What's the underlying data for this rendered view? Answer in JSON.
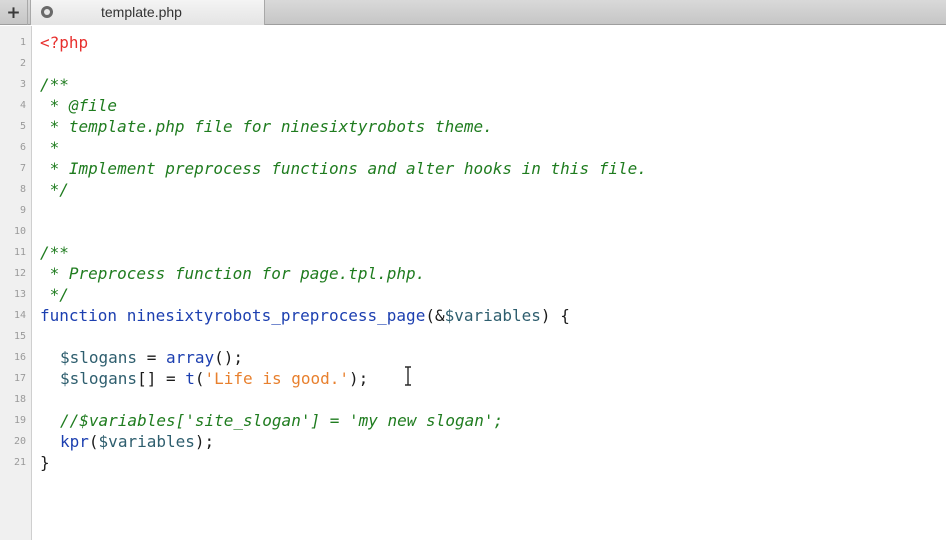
{
  "tabbar": {
    "add_label": "+",
    "tab": {
      "title": "template.php"
    }
  },
  "gutter": {
    "line_numbers": [
      "1",
      "2",
      "3",
      "4",
      "5",
      "6",
      "7",
      "8",
      "9",
      "10",
      "11",
      "12",
      "13",
      "14",
      "15",
      "16",
      "17",
      "18",
      "19",
      "20",
      "21"
    ]
  },
  "code": {
    "line1": "<?php",
    "line3": "/**",
    "line4": " * @file",
    "line5": " * template.php file for ninesixtyrobots theme.",
    "line6": " *",
    "line7": " * Implement preprocess functions and alter hooks in this file.",
    "line8": " */",
    "line11": "/**",
    "line12": " * Preprocess function for page.tpl.php.",
    "line13": " */",
    "line14": {
      "kw": "function",
      "name": "ninesixtyrobots_preprocess_page",
      "open": "(&",
      "var": "$variables",
      "close": ") {"
    },
    "line16": {
      "var": "$slogans",
      "eq": " = ",
      "fn": "array",
      "rest": "();"
    },
    "line17": {
      "var": "$slogans",
      "mid": "[] = ",
      "fn": "t",
      "open": "(",
      "str": "'Life is good.'",
      "close": ");"
    },
    "line19": "//$variables['site_slogan'] = 'my new slogan';",
    "line20": {
      "fn": "kpr",
      "open": "(",
      "var": "$variables",
      "close": ");"
    },
    "line21": "}"
  },
  "colors": {
    "keyword": "#1c3fb0",
    "comment": "#1f7c1f",
    "variable": "#2e5e6e",
    "string": "#e8802e",
    "php_tag": "#e8302e"
  }
}
